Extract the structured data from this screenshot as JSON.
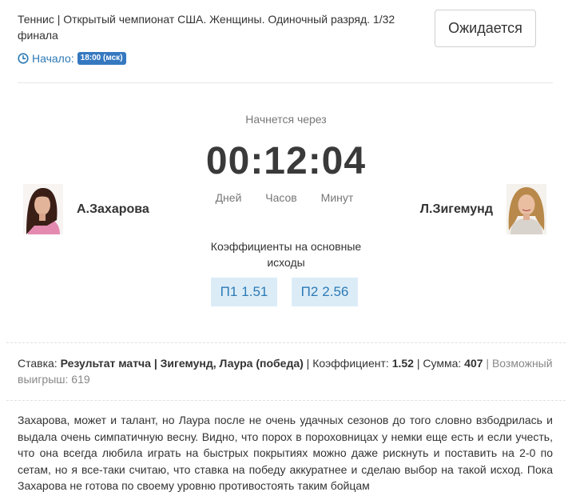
{
  "event": {
    "title": "Теннис | Открытый чемпионат США. Женщины. Одиночный разряд. 1/32 финала",
    "start_label": "Начало:",
    "start_time": "18:00 (мск)",
    "status": "Ожидается"
  },
  "countdown": {
    "label": "Начнется через",
    "value": "00:12:04",
    "units": [
      "Дней",
      "Часов",
      "Минут"
    ]
  },
  "players": {
    "home": {
      "name": "А.Захарова"
    },
    "away": {
      "name": "Л.Зигемунд"
    }
  },
  "odds": {
    "title": "Коэффициенты на основные исходы",
    "items": [
      {
        "label": "П1",
        "value": "1.51"
      },
      {
        "label": "П2",
        "value": "2.56"
      }
    ]
  },
  "bet": {
    "stake_label": "Ставка:",
    "stake_value": "Результат матча | Зигемунд, Лаура (победа)",
    "coef_label": "Коэффициент:",
    "coef_value": "1.52",
    "sum_label": "Сумма:",
    "sum_value": "407",
    "win_label": "Возможный выигрыш:",
    "win_value": "619"
  },
  "analysis": "Захарова, может и талант, но Лаура после не очень удачных сезонов до того словно взбодрилась и выдала очень симпатичную весну. Видно, что порох в пороховницах у немки еще есть и если учесть, что она всегда любила играть на быстрых покрытиях можно даже рискнуть и поставить на 2-0 по сетам, но я все-таки считаю, что ставка на победу аккуратнее и сделаю выбор на такой исход. Пока Захарова не готова по своему уровню противостоять таким бойцам",
  "colors": {
    "accent": "#2d7ab5",
    "badge": "#3578c0",
    "odd_bg": "#dbecf7"
  },
  "icons": {
    "clock": "clock-icon"
  }
}
